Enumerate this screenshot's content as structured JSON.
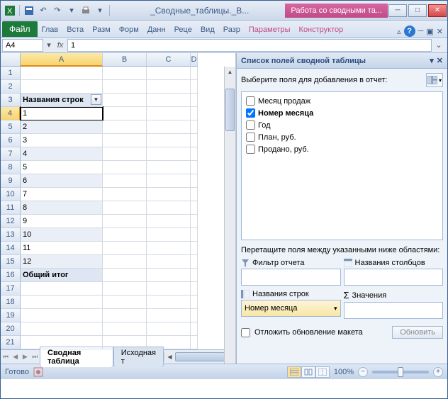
{
  "title": "_Сводные_таблицы._В...",
  "pivot_context": "Работа со сводными та...",
  "ribbon": {
    "file": "Файл",
    "tabs": [
      "Глав",
      "Вста",
      "Разм",
      "Форм",
      "Данн",
      "Реце",
      "Вид",
      "Разр"
    ],
    "ctx_tabs": [
      "Параметры",
      "Конструктор"
    ]
  },
  "namebox": "A4",
  "formula": "1",
  "columns": [
    "A",
    "B",
    "C",
    "D"
  ],
  "rows_data": [
    {
      "n": 1,
      "a": ""
    },
    {
      "n": 2,
      "a": ""
    },
    {
      "n": 3,
      "a": "Названия строк",
      "header": true
    },
    {
      "n": 4,
      "a": "1",
      "active": true
    },
    {
      "n": 5,
      "a": "2"
    },
    {
      "n": 6,
      "a": "3"
    },
    {
      "n": 7,
      "a": "4"
    },
    {
      "n": 8,
      "a": "5"
    },
    {
      "n": 9,
      "a": "6"
    },
    {
      "n": 10,
      "a": "7"
    },
    {
      "n": 11,
      "a": "8"
    },
    {
      "n": 12,
      "a": "9"
    },
    {
      "n": 13,
      "a": "10"
    },
    {
      "n": 14,
      "a": "11"
    },
    {
      "n": 15,
      "a": "12"
    },
    {
      "n": 16,
      "a": "Общий итог",
      "total": true
    },
    {
      "n": 17,
      "a": ""
    },
    {
      "n": 18,
      "a": ""
    },
    {
      "n": 19,
      "a": ""
    },
    {
      "n": 20,
      "a": ""
    },
    {
      "n": 21,
      "a": ""
    }
  ],
  "sheets": {
    "active": "Сводная таблица",
    "other": "Исходная т"
  },
  "pane": {
    "title": "Список полей сводной таблицы",
    "instruction": "Выберите поля для добавления в отчет:",
    "fields": [
      {
        "label": "Месяц продаж",
        "checked": false
      },
      {
        "label": "Номер месяца",
        "checked": true
      },
      {
        "label": "Год",
        "checked": false
      },
      {
        "label": "План, руб.",
        "checked": false
      },
      {
        "label": "Продано, руб.",
        "checked": false
      }
    ],
    "drag_instruction": "Перетащите поля между указанными ниже областями:",
    "zones": {
      "filter": "Фильтр отчета",
      "columns": "Названия столбцов",
      "rows": "Названия строк",
      "values": "Значения",
      "row_item": "Номер месяца"
    },
    "defer": "Отложить обновление макета",
    "update": "Обновить"
  },
  "status": {
    "ready": "Готово",
    "zoom": "100%"
  }
}
